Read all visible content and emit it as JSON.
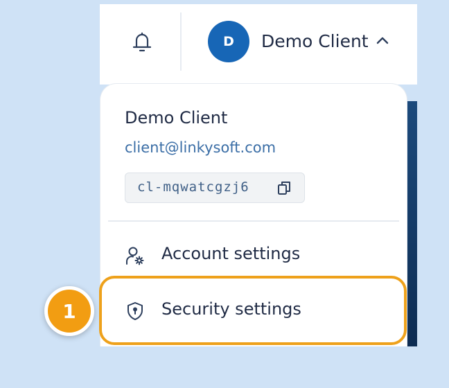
{
  "header": {
    "notifications_icon": "bell-icon",
    "user": {
      "avatar_initial": "D",
      "name": "Demo Client",
      "chevron_icon": "chevron-up-icon"
    }
  },
  "dropdown": {
    "name": "Demo Client",
    "email": "client@linkysoft.com",
    "client_id": "cl-mqwatcgzj6",
    "copy_icon": "copy-icon",
    "menu": [
      {
        "label": "Account settings",
        "icon": "user-gear-icon"
      },
      {
        "label": "Security settings",
        "icon": "shield-lock-icon"
      }
    ]
  },
  "callout": {
    "step": "1",
    "color": "#f29d12"
  }
}
